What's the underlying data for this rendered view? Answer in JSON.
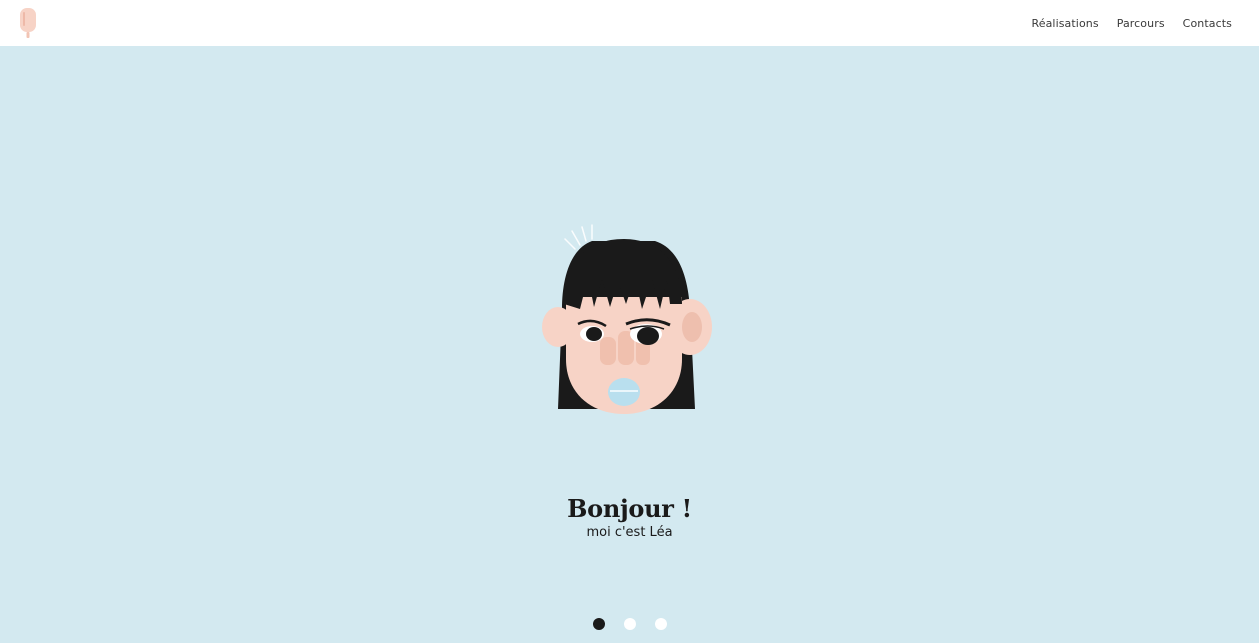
{
  "header": {
    "logo_icon": "popsicle-icon",
    "nav": [
      {
        "label": "Réalisations"
      },
      {
        "label": "Parcours"
      },
      {
        "label": "Contacts"
      }
    ]
  },
  "hero": {
    "illustration": "girl-portrait-illustration",
    "title": "Bonjour !",
    "subtitle": "moi c'est Léa",
    "slides": [
      {
        "active": true
      },
      {
        "active": false
      },
      {
        "active": false
      }
    ]
  },
  "colors": {
    "background": "#d3e9f0",
    "header_bg": "#ffffff",
    "text": "#1a1a1a",
    "skin": "#f7d3c6",
    "hair": "#1a1a1a",
    "accent_blue": "#b9dfee"
  }
}
